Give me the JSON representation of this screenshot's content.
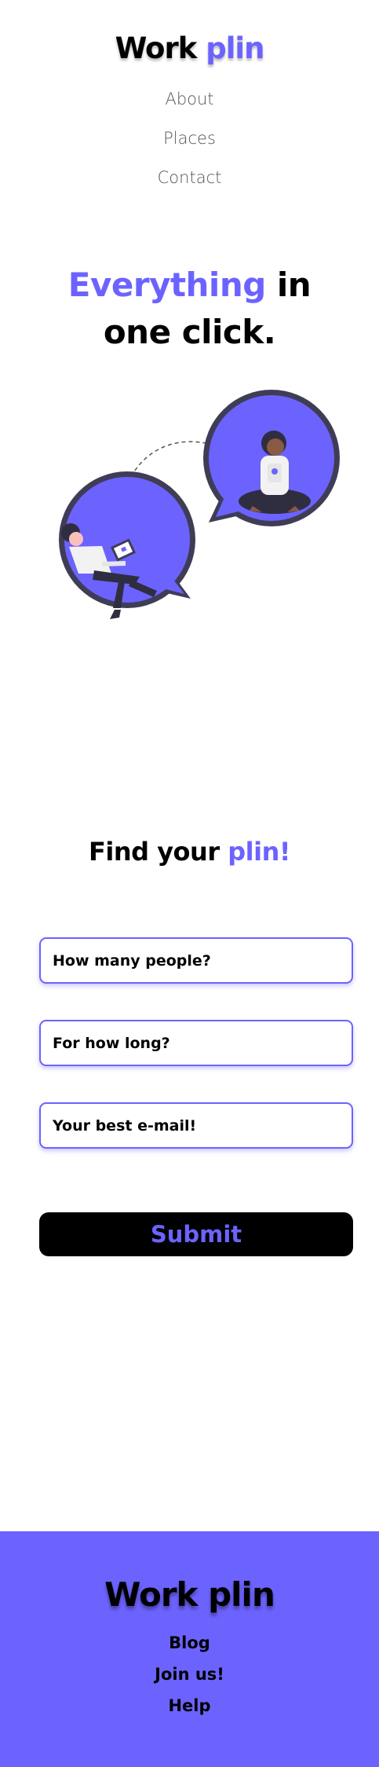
{
  "header": {
    "logo_part1": "Work ",
    "logo_part2": "plin",
    "nav": [
      {
        "label": "About"
      },
      {
        "label": "Places"
      },
      {
        "label": "Contact"
      }
    ]
  },
  "hero": {
    "title_accent": "Everything",
    "title_rest_line1": " in",
    "title_line2": "one click.",
    "illustration": "people-chatting-illustration"
  },
  "form": {
    "title_part1": "Find your ",
    "title_part2": "plin!",
    "fields": [
      {
        "placeholder": "How many people?"
      },
      {
        "placeholder": "For how long?"
      },
      {
        "placeholder": "Your best e-mail!"
      }
    ],
    "submit_label": "Submit"
  },
  "footer": {
    "logo": "Work plin",
    "links": [
      {
        "label": "Blog"
      },
      {
        "label": "Join us!"
      },
      {
        "label": "Help"
      }
    ]
  },
  "colors": {
    "accent": "#6c63ff",
    "text": "#000000",
    "nav_text": "#555555",
    "background": "#ffffff",
    "illustration_dark": "#3f3d56"
  }
}
